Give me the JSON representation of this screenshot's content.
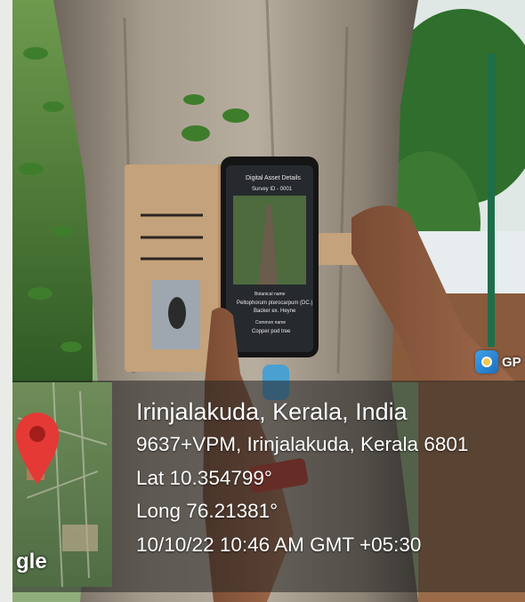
{
  "scene": {
    "description_colors": {
      "bark": "#9a8f80",
      "leaves": "#3f7a2f",
      "wallet": "#c2a07a",
      "overlay": "rgba(40,40,40,0.55)",
      "pin": "#e53935"
    }
  },
  "phone_screen": {
    "header": "Digital Asset Details",
    "survey_id": "Survey ID - 0001",
    "botanical_label": "Botanical name",
    "botanical_name": "Peltophorum pterocarpum (DC.)",
    "botanical_author": "Backer ex. Heyne",
    "common_label": "Common name",
    "common_name": "Copper pod tree"
  },
  "gps_badge": {
    "label": "GP",
    "icon": "gps-map-camera-icon"
  },
  "map_thumbnail": {
    "brand_fragment": "gle",
    "marker": "location-pin-icon"
  },
  "location": {
    "title": "Irinjalakuda, Kerala, India",
    "address": "9637+VPM, Irinjalakuda, Kerala 6801",
    "lat": "Lat 10.354799°",
    "long": "Long 76.21381°",
    "datetime": "10/10/22 10:46 AM GMT +05:30"
  }
}
